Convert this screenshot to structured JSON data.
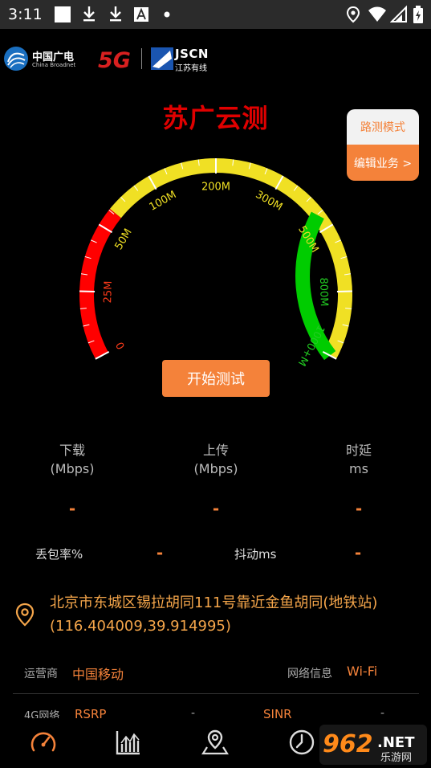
{
  "status_bar": {
    "time": "3:11",
    "icons": [
      "square-icon",
      "download-icon",
      "download-icon",
      "font-icon",
      "dot-icon",
      "location-icon",
      "wifi-icon",
      "signal-icon",
      "battery-icon"
    ]
  },
  "brand": {
    "cbn_name": "中国广电",
    "cbn_sub": "China Broadnet",
    "five_g": "5G",
    "jscn_name": "JSCN",
    "jscn_sub": "江苏有线"
  },
  "app_title": "苏广云测",
  "mode_panel": {
    "road_test": "路测模式",
    "edit_service": "编辑业务 >"
  },
  "gauge": {
    "ticks": [
      "0",
      "25M",
      "50M",
      "100M",
      "200M",
      "300M",
      "500M",
      "800M",
      "1000+M"
    ],
    "tick_colors": [
      "#ff3b1a",
      "#ff3b1a",
      "#f0e024",
      "#f0e024",
      "#f0e024",
      "#f0e024",
      "#f0e024",
      "#22cc22",
      "#22cc22"
    ],
    "arc_colors": {
      "red": "#ff0000",
      "yellow": "#f0e024",
      "green": "#00cc00"
    }
  },
  "start_button": "开始测试",
  "metrics": {
    "download_label": "下载",
    "download_unit": "(Mbps)",
    "download_value": "-",
    "upload_label": "上传",
    "upload_unit": "(Mbps)",
    "upload_value": "-",
    "latency_label": "时延",
    "latency_unit": "ms",
    "latency_value": "-",
    "packet_loss_label": "丢包率%",
    "packet_loss_value": "-",
    "jitter_label": "抖动ms",
    "jitter_value": "-"
  },
  "location": {
    "address": "北京市东城区锡拉胡同111号靠近金鱼胡同(地铁站)(116.404009,39.914995)"
  },
  "network_info": {
    "operator_label": "运营商",
    "operator_value": "中国移动",
    "net_info_label": "网络信息",
    "net_info_value": "Wi-Fi",
    "net_type_label": "4G网络",
    "rsrp_label": "RSRP",
    "rsrp_value": "-",
    "sinr_label": "SINR",
    "sinr_value": "-"
  },
  "bottom_nav": [
    "speedometer-icon",
    "chart-icon",
    "map-pin-icon",
    "clock-icon"
  ],
  "watermark": {
    "number": "962",
    "suffix": ".NET",
    "sub": "乐游网"
  },
  "colors": {
    "accent": "#f4823a",
    "title_red": "#e00000",
    "address": "#f4a54a"
  }
}
